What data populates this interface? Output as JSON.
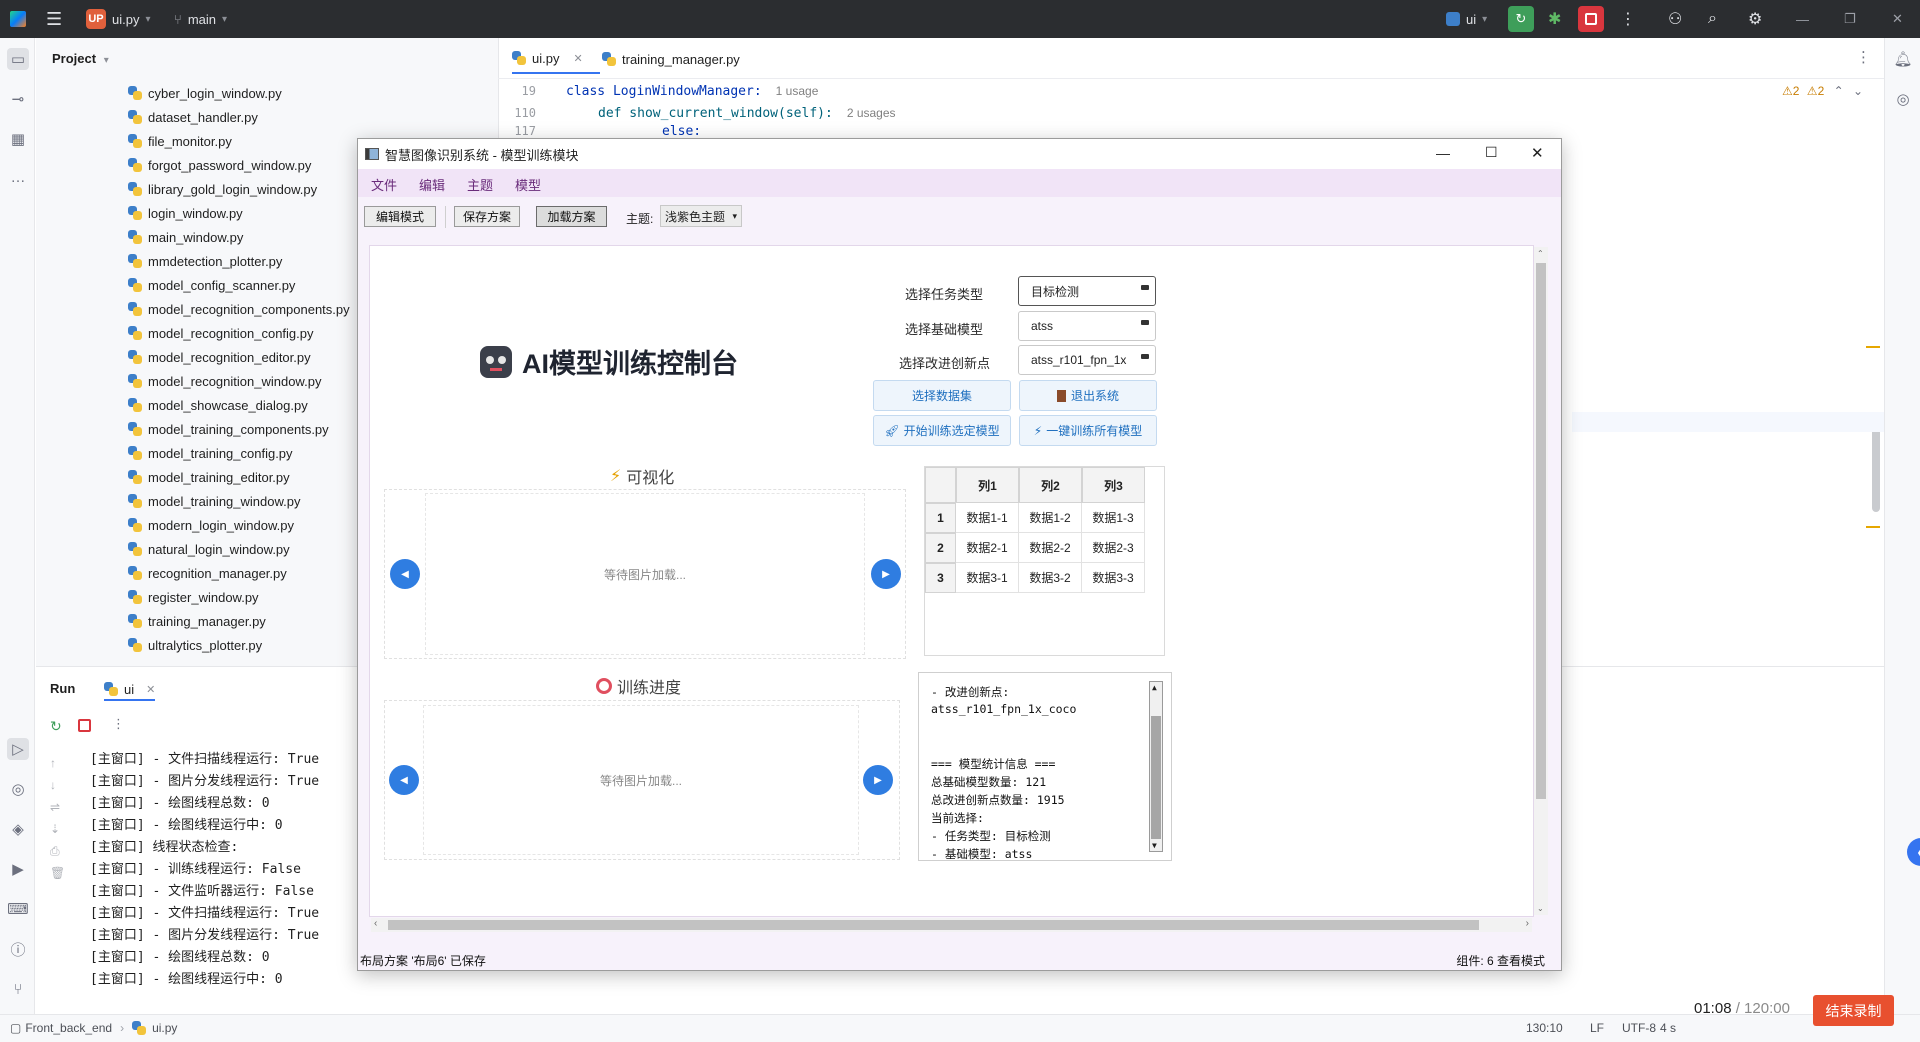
{
  "ide": {
    "titlebar": {
      "file_badge": "UP",
      "file_name": "ui.py",
      "branch": "main",
      "run_config": "ui"
    },
    "project_panel": {
      "title": "Project",
      "files": [
        "cyber_login_window.py",
        "dataset_handler.py",
        "file_monitor.py",
        "forgot_password_window.py",
        "library_gold_login_window.py",
        "login_window.py",
        "main_window.py",
        "mmdetection_plotter.py",
        "model_config_scanner.py",
        "model_recognition_components.py",
        "model_recognition_config.py",
        "model_recognition_editor.py",
        "model_recognition_window.py",
        "model_showcase_dialog.py",
        "model_training_components.py",
        "model_training_config.py",
        "model_training_editor.py",
        "model_training_window.py",
        "modern_login_window.py",
        "natural_login_window.py",
        "recognition_manager.py",
        "register_window.py",
        "training_manager.py",
        "ultralytics_plotter.py"
      ]
    },
    "editor": {
      "tabs": [
        "ui.py",
        "training_manager.py"
      ],
      "lines": [
        {
          "num": "19",
          "code": "class LoginWindowManager:",
          "hint": "1 usage"
        },
        {
          "num": "110",
          "code": "def show_current_window(self):",
          "hint": "2 usages"
        },
        {
          "num": "117",
          "code": "else:",
          "hint": ""
        }
      ],
      "warnings_a": "2",
      "warnings_b": "2"
    },
    "run_panel": {
      "title": "Run",
      "tab": "ui",
      "lines": [
        "[主窗口] - 文件扫描线程运行: True",
        "[主窗口] - 图片分发线程运行: True",
        "[主窗口] - 绘图线程总数: 0",
        "[主窗口] - 绘图线程运行中: 0",
        "[主窗口] 线程状态检查:",
        "[主窗口] - 训练线程运行: False",
        "[主窗口] - 文件监听器运行: False",
        "[主窗口] - 文件扫描线程运行: True",
        "[主窗口] - 图片分发线程运行: True",
        "[主窗口] - 绘图线程总数: 0",
        "[主窗口] - 绘图线程运行中: 0"
      ]
    },
    "statusbar": {
      "project": "Front_back_end",
      "file": "ui.py",
      "position": "130:10",
      "line_sep": "LF",
      "encoding": "UTF-8",
      "indent": "4 s"
    },
    "recording": {
      "elapsed": "01:08",
      "total": "/ 120:00",
      "stop_label": "结束录制"
    }
  },
  "app": {
    "title": "智慧图像识别系统 - 模型训练模块",
    "menu": [
      "文件",
      "编辑",
      "主题",
      "模型"
    ],
    "toolbar": {
      "edit_mode": "编辑模式",
      "save_scheme": "保存方案",
      "load_scheme": "加载方案",
      "theme_label": "主题:",
      "theme_value": "浅紫色主题"
    },
    "heading": "AI模型训练控制台",
    "form": {
      "task_label": "选择任务类型",
      "task_value": "目标检测",
      "base_label": "选择基础模型",
      "base_value": "atss",
      "innov_label": "选择改进创新点",
      "innov_value": "atss_r101_fpn_1x",
      "select_dataset": "选择数据集",
      "exit_system": "退出系统",
      "start_training": "开始训练选定模型",
      "train_all": "一键训练所有模型"
    },
    "visual": {
      "title": "可视化",
      "placeholder": "等待图片加载..."
    },
    "progress": {
      "title": "训练进度",
      "placeholder": "等待图片加载..."
    },
    "table": {
      "headers": [
        "列1",
        "列2",
        "列3"
      ],
      "row_labels": [
        "1",
        "2",
        "3"
      ],
      "rows": [
        [
          "数据1-1",
          "数据1-2",
          "数据1-3"
        ],
        [
          "数据2-1",
          "数据2-2",
          "数据2-3"
        ],
        [
          "数据3-1",
          "数据3-2",
          "数据3-3"
        ]
      ]
    },
    "log": [
      "- 改进创新点:",
      "atss_r101_fpn_1x_coco",
      "",
      "",
      "=== 模型统计信息 ===",
      "总基础模型数量: 121",
      "总改进创新点数量: 1915",
      "当前选择:",
      "- 任务类型: 目标检测",
      "- 基础模型: atss"
    ],
    "status": {
      "left": "布局方案 '布局6' 已保存",
      "right": "组件: 6  查看模式"
    }
  }
}
